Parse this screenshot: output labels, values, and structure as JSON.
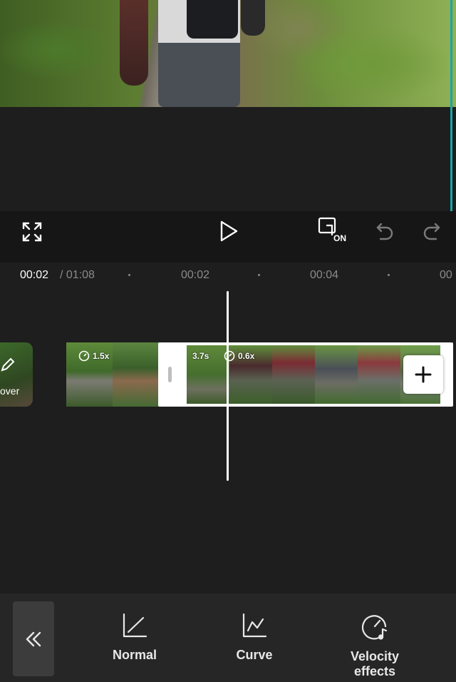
{
  "player": {
    "current_time": "00:02",
    "total_time": "/ 01:08",
    "icons": [
      "fullscreen-icon",
      "play-icon",
      "keyframe-on-icon",
      "undo-icon",
      "redo-icon"
    ],
    "keyframe_badge": "ON"
  },
  "ruler": {
    "ticks": [
      "00:02",
      "00:04",
      "00"
    ]
  },
  "timeline": {
    "cover_label": "over",
    "clips": [
      {
        "speed": "1.5x"
      },
      {
        "duration": "3.7s",
        "speed": "0.6x"
      }
    ],
    "add_icon": "plus-icon"
  },
  "toolbar": {
    "back_icon": "double-chevron-left-icon",
    "tools": [
      {
        "label": "Normal",
        "icon": "normal-speed-icon"
      },
      {
        "label": "Curve",
        "icon": "curve-speed-icon"
      },
      {
        "label": "Velocity\neffects",
        "icon": "velocity-effects-icon"
      }
    ]
  },
  "colors": {
    "background": "#1e1e1e",
    "control_bar": "#161616",
    "toolbar": "#262626",
    "accent_edge": "#1aa6a6"
  }
}
